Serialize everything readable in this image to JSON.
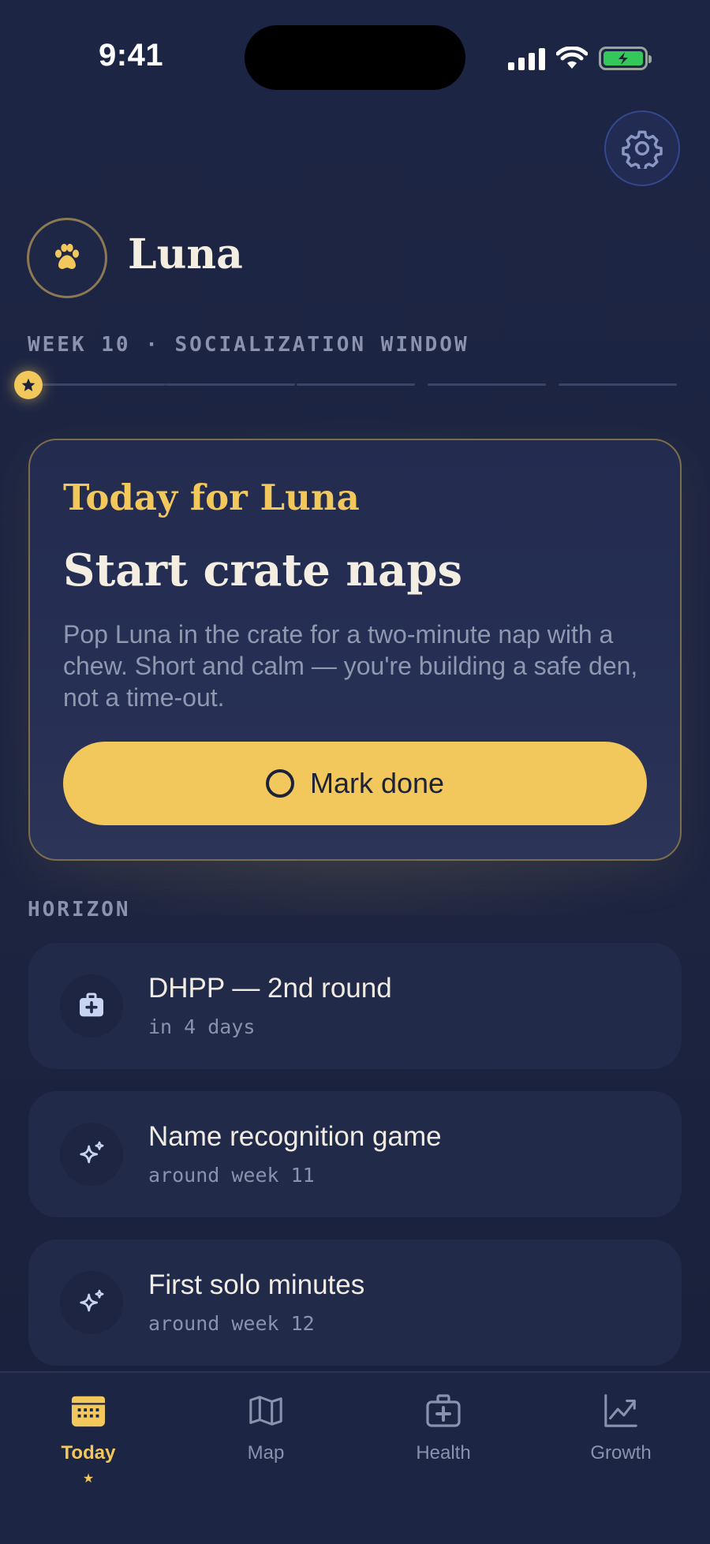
{
  "status_bar": {
    "time": "9:41"
  },
  "header": {
    "pet_name": "Luna",
    "week_label": "WEEK 10 · SOCIALIZATION WINDOW"
  },
  "today": {
    "kicker": "Today for Luna",
    "title": "Start crate naps",
    "body": "Pop Luna in the crate for a two-minute nap with a chew. Short and calm — you're building a safe den, not a time-out.",
    "button_label": "Mark done"
  },
  "horizon": {
    "label": "HORIZON",
    "items": [
      {
        "title": "DHPP — 2nd round",
        "subtitle": "in 4 days",
        "icon": "medical-kit-icon"
      },
      {
        "title": "Name recognition game",
        "subtitle": "around week 11",
        "icon": "sparkles-icon"
      },
      {
        "title": "First solo minutes",
        "subtitle": "around week 12",
        "icon": "sparkles-icon"
      }
    ]
  },
  "tabs": [
    {
      "label": "Today",
      "icon": "calendar-icon",
      "active": true,
      "indicator": "★"
    },
    {
      "label": "Map",
      "icon": "map-icon",
      "active": false
    },
    {
      "label": "Health",
      "icon": "medical-kit-icon",
      "active": false
    },
    {
      "label": "Growth",
      "icon": "chart-icon",
      "active": false
    }
  ],
  "colors": {
    "background": "#1d2544",
    "accent": "#f2c75c",
    "card": "#222a4a",
    "text": "#f1ece2",
    "muted": "#8a92ad",
    "battery": "#34c759"
  },
  "progress": {
    "current_segment": 1,
    "total_segments": 5
  }
}
